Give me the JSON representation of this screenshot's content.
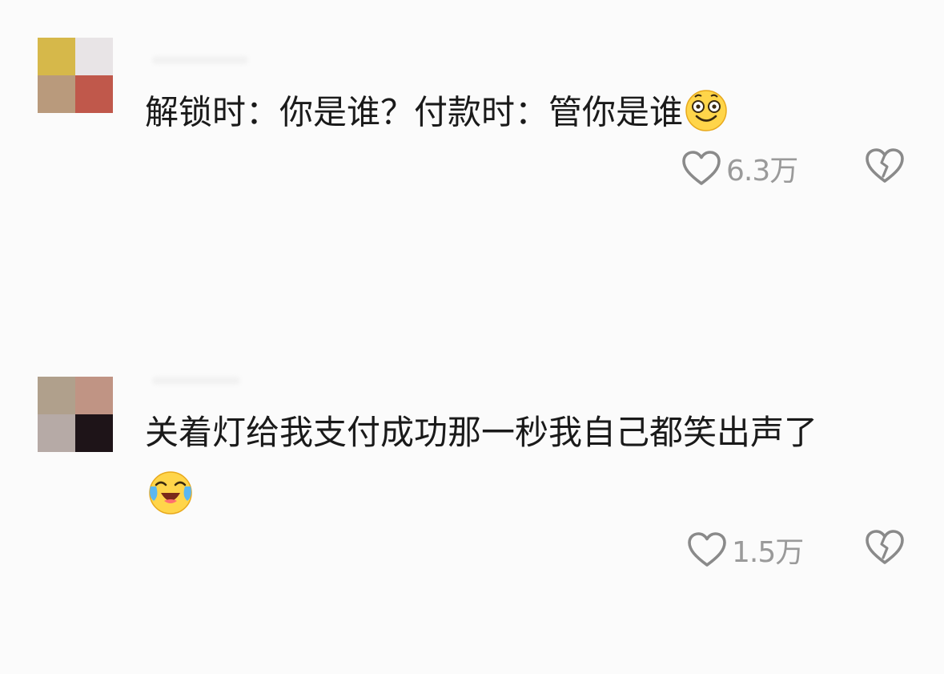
{
  "comments": [
    {
      "text": "解锁时：你是谁？付款时：管你是谁",
      "emoji": "smile-emoji",
      "likes": "6.3万",
      "avatar_colors": [
        "#d6b84a",
        "#e8e4e6",
        "#b99a7c",
        "#c0584b"
      ]
    },
    {
      "text": "关着灯给我支付成功那一秒我自己都笑出声了",
      "emoji": "laugh-cry-emoji",
      "likes": "1.5万",
      "avatar_colors": [
        "#b0a08c",
        "#c09484",
        "#b6aaa6",
        "#1e1418"
      ]
    }
  ],
  "icons": {
    "like": "heart-outline-icon",
    "dislike": "broken-heart-icon"
  },
  "colors": {
    "icon_gray": "#8a8a8a",
    "count_gray": "#9a9a9a",
    "emoji_yellow": "#ffd54a"
  }
}
